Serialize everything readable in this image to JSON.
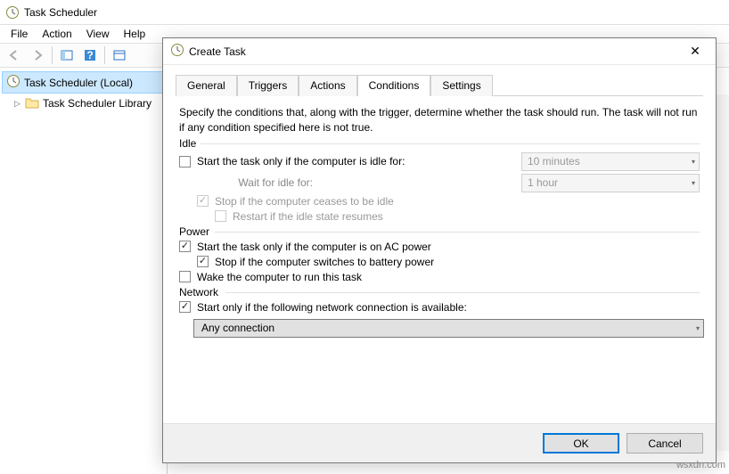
{
  "app": {
    "title": "Task Scheduler",
    "menu": [
      "File",
      "Action",
      "View",
      "Help"
    ]
  },
  "sidebar": {
    "root": "Task Scheduler (Local)",
    "child": "Task Scheduler Library"
  },
  "dialog": {
    "title": "Create Task",
    "tabs": [
      "General",
      "Triggers",
      "Actions",
      "Conditions",
      "Settings"
    ],
    "active_tab": 3,
    "description": "Specify the conditions that, along with the trigger, determine whether the task should run.  The task will not run  if any condition specified here is not true.",
    "idle": {
      "label": "Idle",
      "start_if_idle": "Start the task only if the computer is idle for:",
      "idle_duration": "10 minutes",
      "wait_label": "Wait for idle for:",
      "wait_duration": "1 hour",
      "stop_if_ceases": "Stop if the computer ceases to be idle",
      "restart_if_resumes": "Restart if the idle state resumes"
    },
    "power": {
      "label": "Power",
      "ac_only": "Start the task only if the computer is on AC power",
      "stop_on_battery": "Stop if the computer switches to battery power",
      "wake": "Wake the computer to run this task"
    },
    "network": {
      "label": "Network",
      "only_if_available": "Start only if the following network connection is available:",
      "selected": "Any connection"
    },
    "buttons": {
      "ok": "OK",
      "cancel": "Cancel"
    }
  },
  "watermark": "wsxdn.com"
}
